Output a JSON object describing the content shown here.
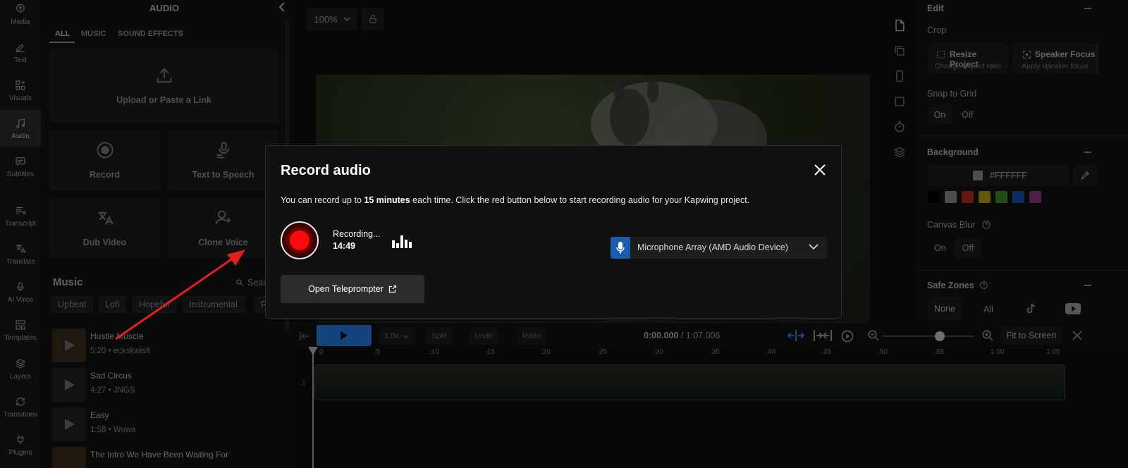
{
  "rail": {
    "items": [
      {
        "label": "Media"
      },
      {
        "label": "Text"
      },
      {
        "label": "Visuals"
      },
      {
        "label": "Audio"
      },
      {
        "label": "Subtitles"
      },
      {
        "label": "Transcript"
      },
      {
        "label": "Translate"
      },
      {
        "label": "AI Voice"
      },
      {
        "label": "Templates"
      },
      {
        "label": "Layers"
      },
      {
        "label": "Transitions"
      },
      {
        "label": "Plugins"
      }
    ]
  },
  "audio_panel": {
    "title": "AUDIO",
    "tabs": [
      "ALL",
      "MUSIC",
      "SOUND EFFECTS"
    ],
    "upload_label": "Upload or Paste a Link",
    "tiles": [
      "Record",
      "Text to Speech",
      "Dub Video",
      "Clone Voice"
    ],
    "music_heading": "Music",
    "search_label": "Sear",
    "chips": [
      "Upbeat",
      "Lofi",
      "Hopeful",
      "Instrumental",
      "R"
    ],
    "tracks": [
      {
        "name": "Hustle Muscle",
        "meta": "5:20 • eckskwisit"
      },
      {
        "name": "Sad Circus",
        "meta": "4:27 • JNGS"
      },
      {
        "name": "Easy",
        "meta": "1:58 • Wowa"
      },
      {
        "name": "The Intro We Have Been Waiting For",
        "meta": ""
      }
    ]
  },
  "canvas": {
    "zoom": "100%"
  },
  "right_panel": {
    "edit_heading": "Edit",
    "crop_label": "Crop",
    "resize_title": "Resize Project",
    "resize_sub": "Change aspect ratio",
    "speaker_title": "Speaker Focus",
    "speaker_sub": "Apply speaker focus",
    "snap_label": "Snap to Grid",
    "on": "On",
    "off": "Off",
    "background_heading": "Background",
    "bg_color": "#FFFFFF",
    "swatches": [
      "#000000",
      "#6b6b6b",
      "#8a1f1f",
      "#8a7a10",
      "#2f6b22",
      "#123f86",
      "#6a2a66"
    ],
    "blur_label": "Canvas Blur",
    "safe_heading": "Safe Zones",
    "safe_none": "None",
    "safe_all": "All"
  },
  "timeline": {
    "speed": "1.0x",
    "split": "Split",
    "undo": "Undo",
    "redo": "Redo",
    "time_current": "0:00.000",
    "time_sep": " / ",
    "time_total": "1:07.006",
    "fit_label": "Fit to Screen",
    "track_number": "1",
    "ticks": [
      "0",
      ":5",
      ":10",
      ":15",
      ":20",
      ":25",
      ":30",
      ":35",
      ":40",
      ":45",
      ":50",
      ":55",
      "1:00",
      "1:05"
    ],
    "zoom_level": 0.62
  },
  "modal": {
    "title": "Record audio",
    "desc_pre": "You can record up to ",
    "desc_bold": "15 minutes",
    "desc_post": " each time. Click the red button below to start recording audio for your Kapwing project.",
    "status": "Recording...",
    "time": "14:49",
    "mic_device": "Microphone Array (AMD Audio Device)",
    "teleprompter_label": "Open Teleprompter"
  },
  "colors": {
    "record_red": "#ff0a0a",
    "mic_blue": "#1b5cae",
    "play_blue": "#1d5dae",
    "arrow_red": "#e0201a"
  }
}
